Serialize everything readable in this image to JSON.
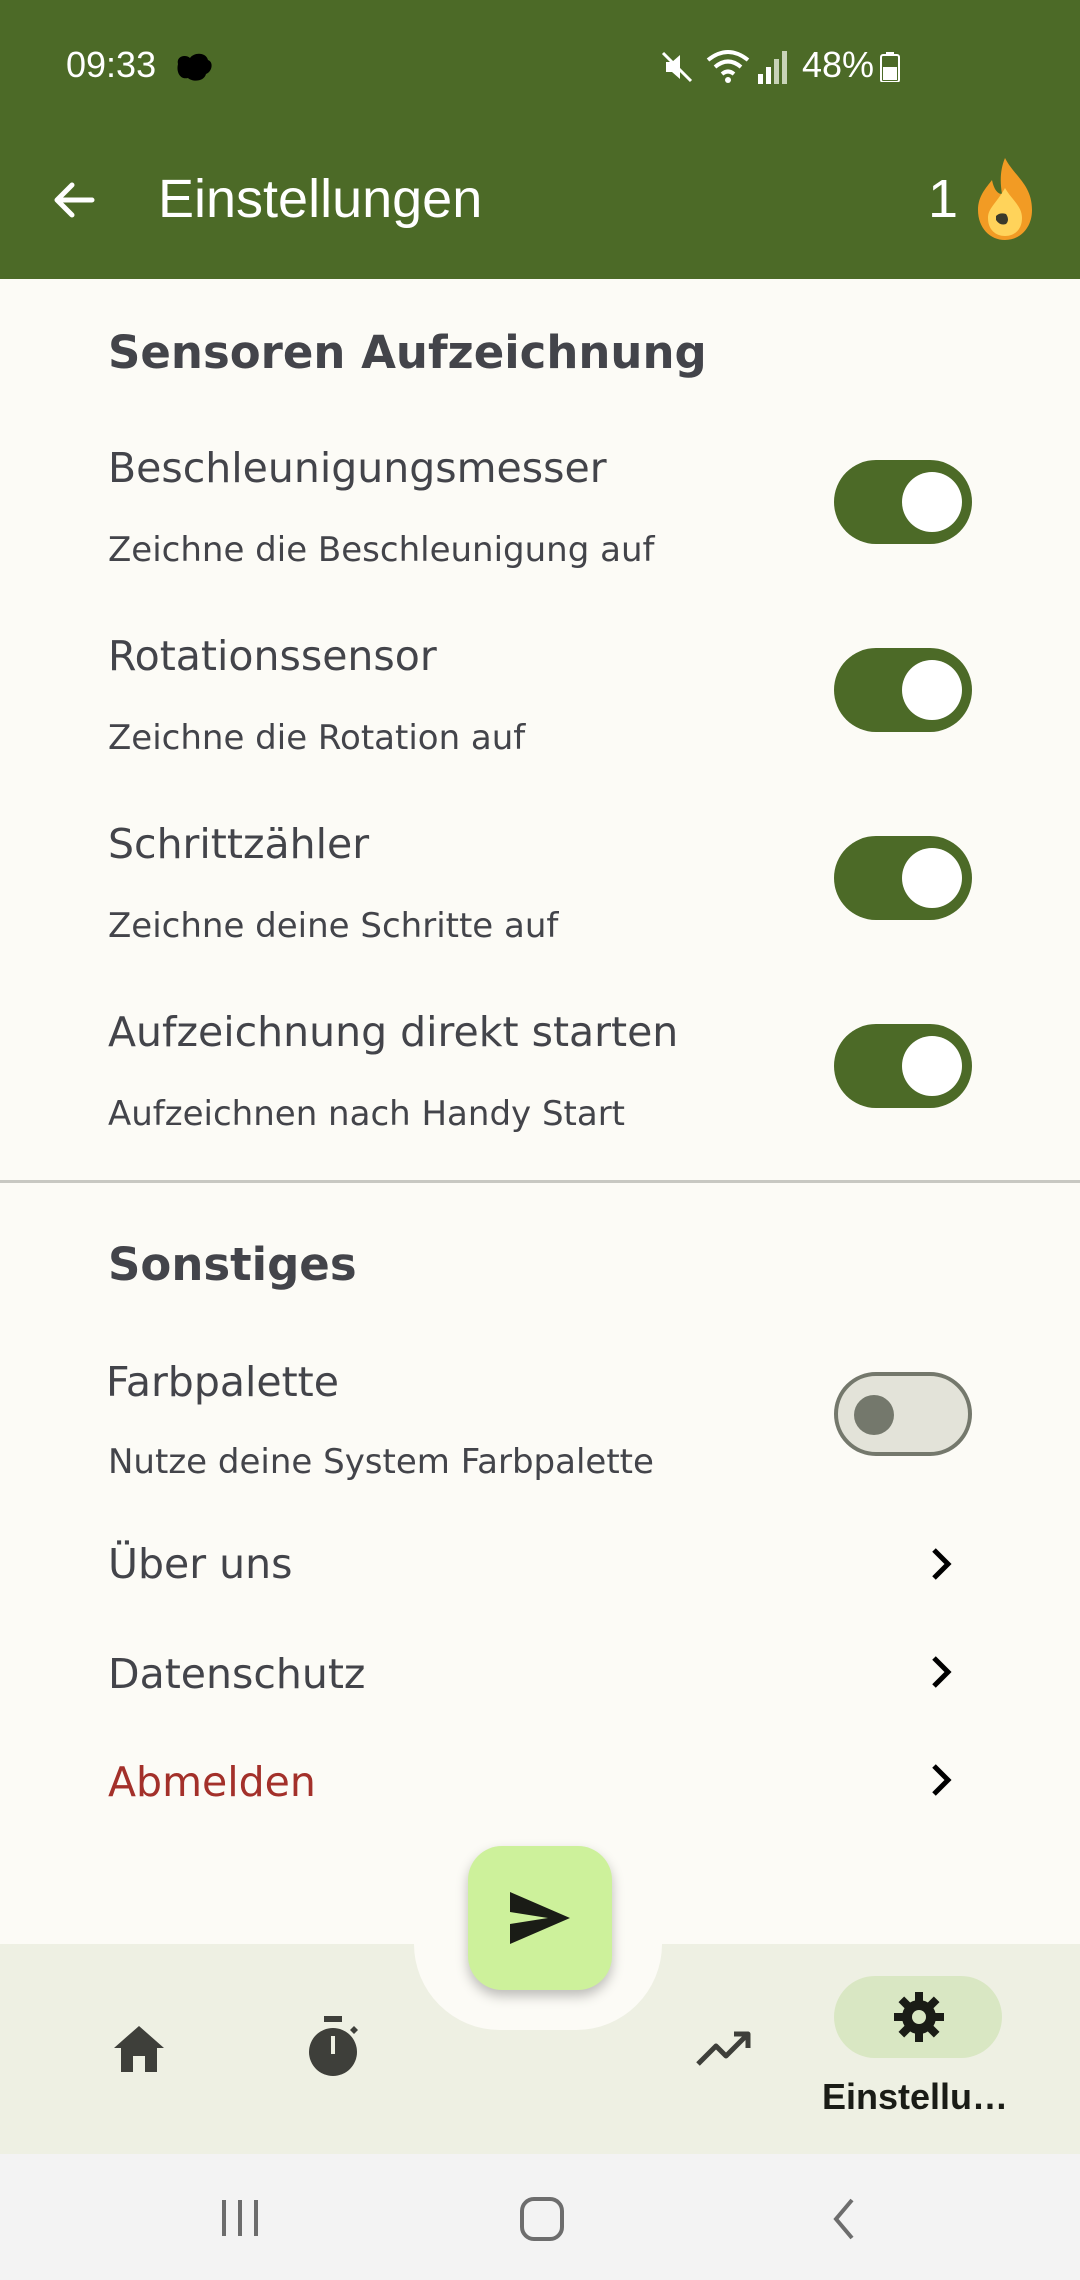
{
  "status_bar": {
    "time": "09:33",
    "battery_percent": "48%",
    "icons": [
      "notification-blob-icon",
      "mute-icon",
      "wifi-icon",
      "signal-icon",
      "battery-icon"
    ]
  },
  "app_bar": {
    "title": "Einstellungen",
    "streak_count": "1",
    "back_icon": "arrow-back-icon",
    "streak_icon": "flame-icon",
    "color": "#4c6a27"
  },
  "sections": {
    "sensors": {
      "title": "Sensoren Aufzeichnung",
      "items": [
        {
          "title": "Beschleunigungsmesser",
          "subtitle": "Zeichne die Beschleunigung auf",
          "enabled": true
        },
        {
          "title": "Rotationssensor",
          "subtitle": "Zeichne die Rotation auf",
          "enabled": true
        },
        {
          "title": "Schrittzähler",
          "subtitle": "Zeichne deine Schritte auf",
          "enabled": true
        },
        {
          "title": "Aufzeichnung direkt starten",
          "subtitle": "Aufzeichnen nach Handy Start",
          "enabled": true
        }
      ]
    },
    "other": {
      "title": "Sonstiges",
      "palette": {
        "title": "Farbpalette",
        "subtitle": "Nutze deine System Farbpalette",
        "enabled": false
      },
      "links": [
        {
          "label": "Über uns"
        },
        {
          "label": "Datenschutz"
        },
        {
          "label": "Abmelden",
          "color": "#a3302a"
        }
      ]
    }
  },
  "fab": {
    "icon": "send-icon",
    "color": "#cdf19b"
  },
  "bottom_nav": {
    "items": [
      {
        "icon": "home-icon"
      },
      {
        "icon": "stopwatch-icon"
      },
      {
        "icon": "trending-icon"
      },
      {
        "icon": "gear-icon",
        "label": "Einstellu…",
        "selected": true
      }
    ]
  },
  "system_nav": {
    "icons": [
      "recents-icon",
      "home-circle-icon",
      "back-chevron-icon"
    ]
  }
}
